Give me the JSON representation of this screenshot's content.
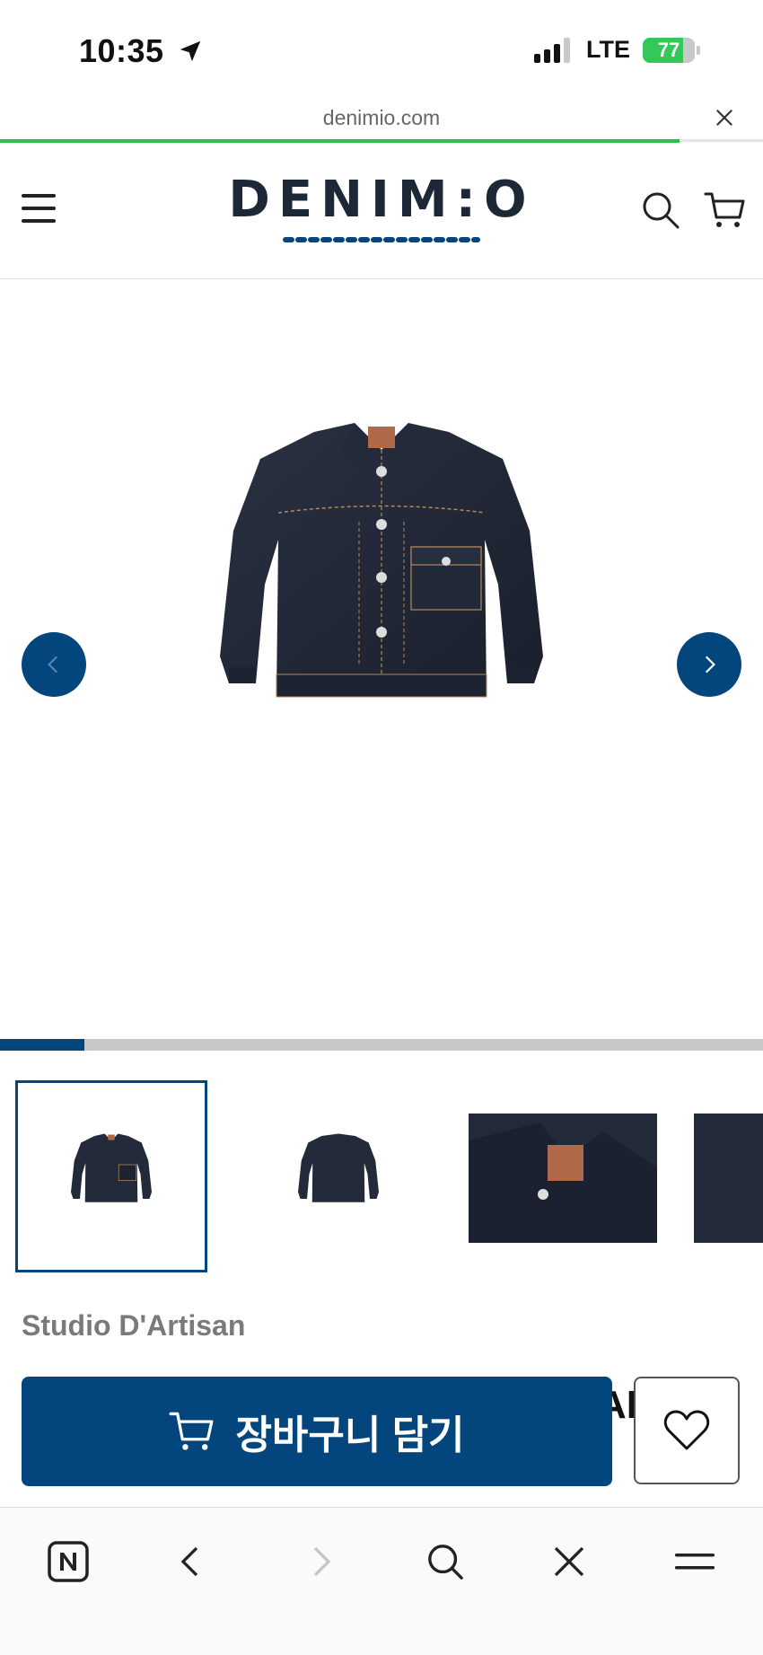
{
  "status_bar": {
    "time": "10:35",
    "network": "LTE",
    "battery_percent": 77,
    "battery_label": "77"
  },
  "browser": {
    "url": "denimio.com",
    "page_load_progress": 0.89
  },
  "header": {
    "logo_text": "DENIM:O",
    "brand_color": "#03467d"
  },
  "gallery": {
    "image_progress": 0.11,
    "thumbnails": [
      {
        "icon": "jacket-front-thumb"
      },
      {
        "icon": "jacket-back-thumb"
      },
      {
        "icon": "jacket-collar-detail-thumb"
      },
      {
        "icon": "jacket-cuff-detail-thumb"
      }
    ],
    "active_thumbnail": 0
  },
  "product": {
    "brand": "Studio D'Artisan",
    "title_partial": "AI"
  },
  "actions": {
    "add_to_cart_label": "장바구니 담기"
  },
  "bottom_nav": [
    {
      "icon": "naver-home-icon"
    },
    {
      "icon": "back-arrow-icon"
    },
    {
      "icon": "forward-arrow-icon"
    },
    {
      "icon": "search-icon"
    },
    {
      "icon": "close-icon"
    },
    {
      "icon": "menu-icon"
    }
  ]
}
